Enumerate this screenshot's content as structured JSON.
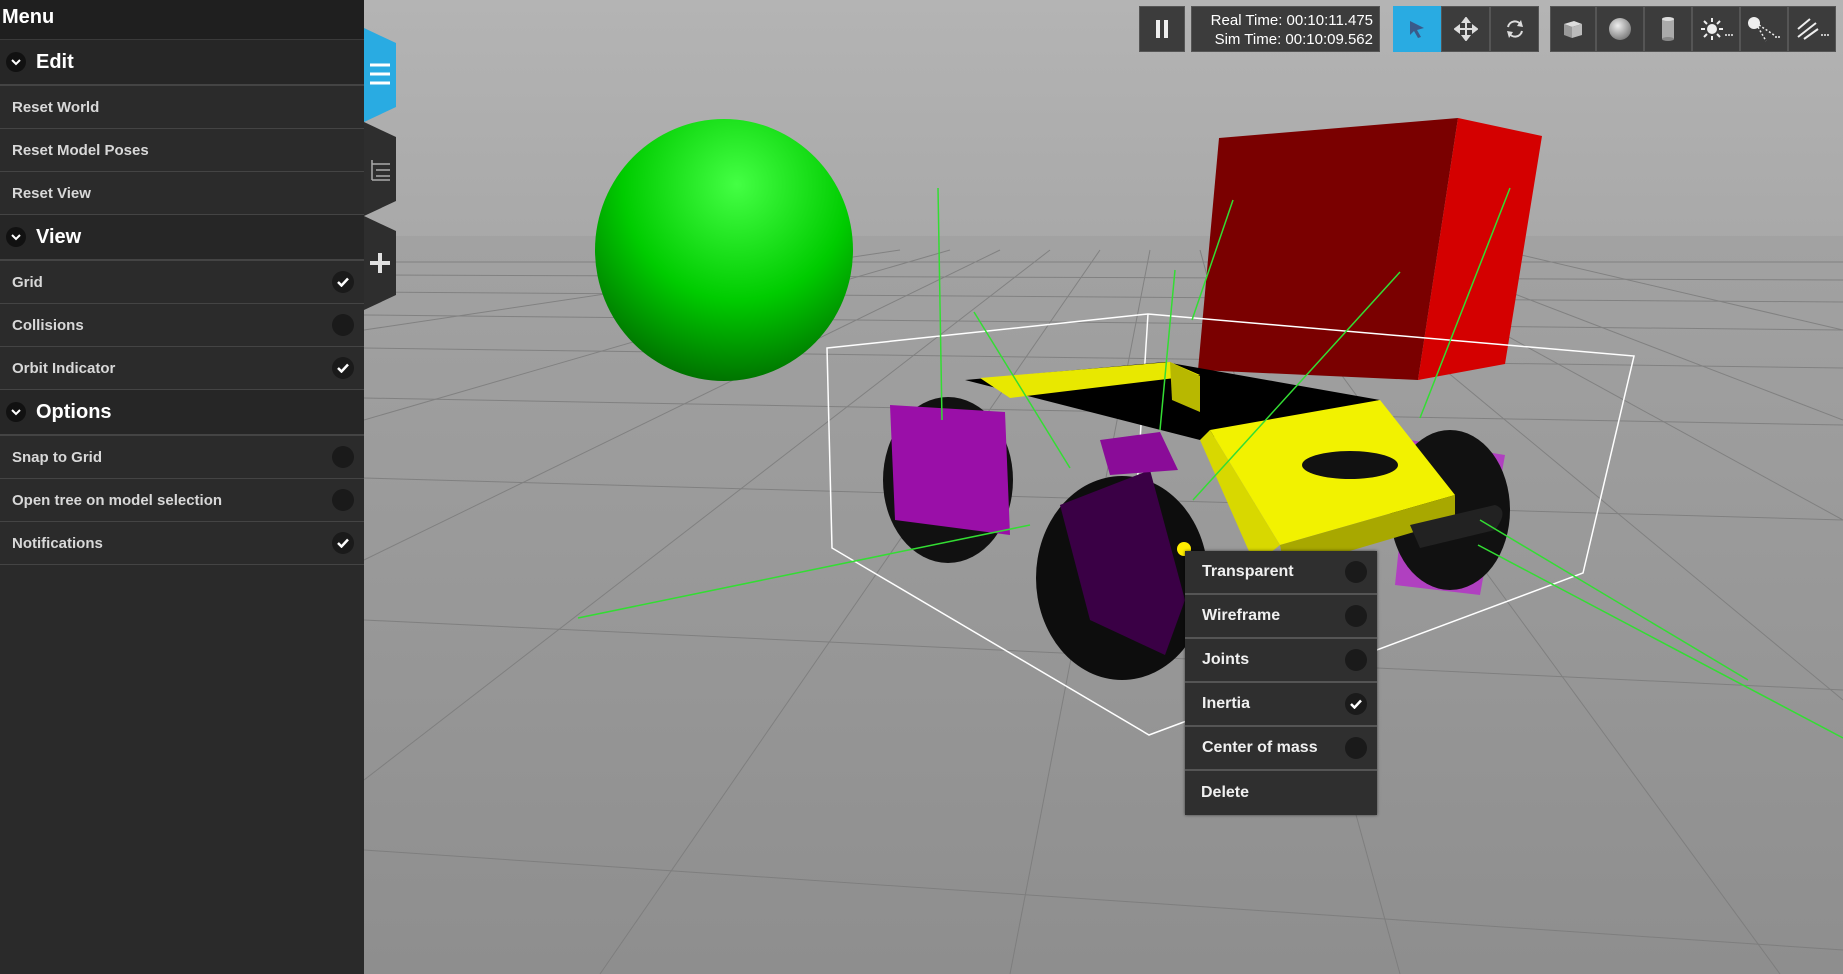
{
  "menu": {
    "title": "Menu",
    "sections": [
      {
        "label": "Edit",
        "items": [
          {
            "label": "Reset World"
          },
          {
            "label": "Reset Model Poses"
          },
          {
            "label": "Reset View"
          }
        ]
      },
      {
        "label": "View",
        "items": [
          {
            "label": "Grid",
            "checked": true
          },
          {
            "label": "Collisions",
            "checked": false
          },
          {
            "label": "Orbit Indicator",
            "checked": true
          }
        ]
      },
      {
        "label": "Options",
        "items": [
          {
            "label": "Snap to Grid",
            "checked": false
          },
          {
            "label": "Open tree on model selection",
            "checked": false
          },
          {
            "label": "Notifications",
            "checked": true
          }
        ]
      }
    ]
  },
  "toolbar": {
    "real_time": "Real Time: 00:10:11.475",
    "sim_time": "Sim Time: 00:10:09.562",
    "active_tool": "select"
  },
  "context_menu": {
    "items": [
      {
        "label": "Transparent",
        "checked": false
      },
      {
        "label": "Wireframe",
        "checked": false
      },
      {
        "label": "Joints",
        "checked": false
      },
      {
        "label": "Inertia",
        "checked": true
      },
      {
        "label": "Center of mass",
        "checked": false
      },
      {
        "label": "Delete"
      }
    ]
  },
  "colors": {
    "accent": "#29abe2",
    "panel": "#2a2a2a",
    "sphere": "#00dd00",
    "box": "#cc0000",
    "robot_body": "#f2f200",
    "robot_wheels": "#a020c0"
  }
}
